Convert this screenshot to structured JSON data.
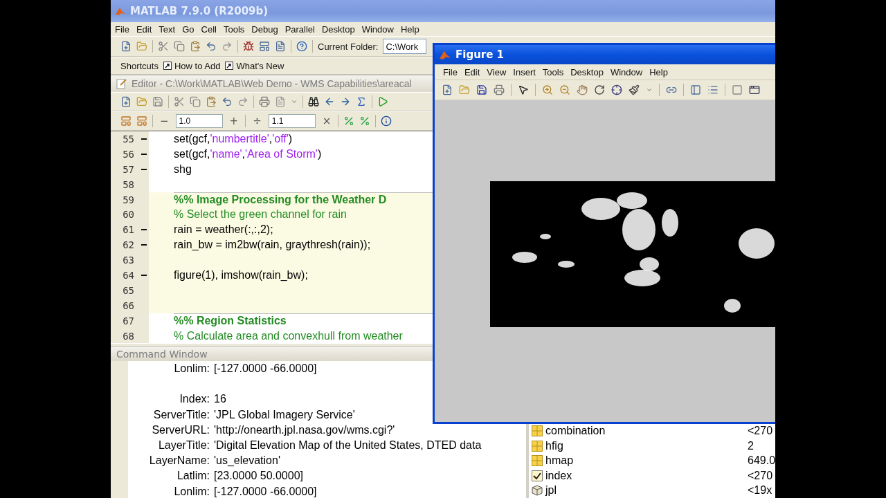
{
  "window": {
    "title": "MATLAB 7.9.0 (R2009b)"
  },
  "menu": [
    "File",
    "Edit",
    "Text",
    "Go",
    "Cell",
    "Tools",
    "Debug",
    "Parallel",
    "Desktop",
    "Window",
    "Help"
  ],
  "toolbar": {
    "current_folder_label": "Current Folder:",
    "current_folder": "C:\\Work"
  },
  "shortcuts": [
    {
      "label": "Shortcuts",
      "kind": "plain"
    },
    {
      "label": "How to Add",
      "kind": "link"
    },
    {
      "label": "What's New",
      "kind": "link"
    }
  ],
  "editor": {
    "title": "Editor - C:\\Work\\MATLAB\\Web Demo - WMS Capabilities\\areacal",
    "cell_toolbar": {
      "minus": "−",
      "first_value": "1.0",
      "plus": "+",
      "divide": "÷",
      "second_value": "1.1",
      "times": "×"
    },
    "lines": [
      {
        "number": "55",
        "executable": true,
        "in_cell": false,
        "kind": "code",
        "tokens": [
          {
            "kind": "code",
            "text": "set(gcf,"
          },
          {
            "kind": "string",
            "text": "'numbertitle'"
          },
          {
            "kind": "code",
            "text": ","
          },
          {
            "kind": "string",
            "text": "'off'"
          },
          {
            "kind": "code",
            "text": ")"
          }
        ]
      },
      {
        "number": "56",
        "executable": true,
        "in_cell": false,
        "kind": "code",
        "tokens": [
          {
            "kind": "code",
            "text": "set(gcf,"
          },
          {
            "kind": "string",
            "text": "'name'"
          },
          {
            "kind": "code",
            "text": ","
          },
          {
            "kind": "string",
            "text": "'Area of Storm'"
          },
          {
            "kind": "code",
            "text": ")"
          }
        ]
      },
      {
        "number": "57",
        "executable": true,
        "in_cell": false,
        "kind": "code",
        "tokens": [
          {
            "kind": "code",
            "text": "shg"
          }
        ]
      },
      {
        "number": "58",
        "executable": false,
        "in_cell": false,
        "kind": "blank"
      },
      {
        "number": "59",
        "executable": false,
        "in_cell": true,
        "kind": "cell_title",
        "tokens": [
          {
            "kind": "cell_title",
            "text": "%% Image Processing for the Weather D"
          }
        ]
      },
      {
        "number": "60",
        "executable": false,
        "in_cell": true,
        "kind": "code",
        "tokens": [
          {
            "kind": "comment",
            "text": "% Select the green channel for rain"
          }
        ]
      },
      {
        "number": "61",
        "executable": true,
        "in_cell": true,
        "kind": "code",
        "tokens": [
          {
            "kind": "code",
            "text": "rain = weather(:,:,2);"
          }
        ]
      },
      {
        "number": "62",
        "executable": true,
        "in_cell": true,
        "kind": "code",
        "tokens": [
          {
            "kind": "code",
            "text": "rain_bw = im2bw(rain, graythresh(rain));"
          }
        ]
      },
      {
        "number": "63",
        "executable": false,
        "in_cell": true,
        "kind": "blank"
      },
      {
        "number": "64",
        "executable": true,
        "in_cell": true,
        "kind": "code",
        "tokens": [
          {
            "kind": "code",
            "text": "figure(1), imshow(rain_bw);"
          }
        ]
      },
      {
        "number": "65",
        "executable": false,
        "in_cell": true,
        "kind": "blank"
      },
      {
        "number": "66",
        "executable": false,
        "in_cell": true,
        "kind": "blank"
      },
      {
        "number": "67",
        "executable": false,
        "in_cell": false,
        "kind": "cell_title",
        "tokens": [
          {
            "kind": "cell_title",
            "text": "%% Region Statistics"
          }
        ]
      },
      {
        "number": "68",
        "executable": false,
        "in_cell": false,
        "kind": "code",
        "tokens": [
          {
            "kind": "comment",
            "text": "% Calculate area and convexhull from weather"
          }
        ]
      }
    ]
  },
  "command_window": {
    "title": "Command Window",
    "lines": [
      {
        "kind": "field",
        "key": "Lonlim:",
        "value": "[-127.0000 -66.0000]"
      },
      {
        "kind": "blank"
      },
      {
        "kind": "field",
        "key": "Index:",
        "value": "16"
      },
      {
        "kind": "field",
        "key": "ServerTitle:",
        "value": "'JPL Global Imagery Service'"
      },
      {
        "kind": "field",
        "key": "ServerURL:",
        "value": "'http://onearth.jpl.nasa.gov/wms.cgi?'"
      },
      {
        "kind": "field",
        "key": "LayerTitle:",
        "value": "'Digital Elevation Map of the United States, DTED data"
      },
      {
        "kind": "field",
        "key": "LayerName:",
        "value": "'us_elevation'"
      },
      {
        "kind": "field",
        "key": "Latlim:",
        "value": "[23.0000 50.0000]"
      },
      {
        "kind": "field",
        "key": "Lonlim:",
        "value": "[-127.0000 -66.0000]"
      }
    ]
  },
  "workspace": {
    "rows": [
      {
        "kind": "matrix",
        "name": "combination",
        "value": "<270"
      },
      {
        "kind": "matrix",
        "name": "hfig",
        "value": "2"
      },
      {
        "kind": "matrix",
        "name": "hmap",
        "value": "649.0"
      },
      {
        "kind": "logical",
        "name": "index",
        "value": "<270"
      },
      {
        "kind": "object",
        "name": "jpl",
        "value": "<19x"
      }
    ]
  },
  "figure": {
    "title": "Figure 1",
    "menu": [
      "File",
      "Edit",
      "View",
      "Insert",
      "Tools",
      "Desktop",
      "Window",
      "Help"
    ],
    "image": {
      "kind": "picture"
    }
  }
}
